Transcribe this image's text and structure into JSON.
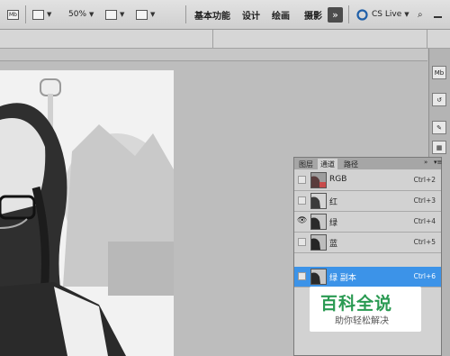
{
  "toolbar": {
    "mb_label": "Mb",
    "zoom_value": "50%",
    "workspaces": [
      "基本功能",
      "设计",
      "绘画",
      "摄影"
    ],
    "more_label": "»",
    "cslive_label": "CS Live"
  },
  "dock": {
    "icons": [
      "mini-bridge-icon",
      "history-icon",
      "brush-icon",
      "grid-icon"
    ],
    "mb_label": "Mb"
  },
  "channels_panel": {
    "tabs": [
      "图层",
      "通道",
      "路径"
    ],
    "active_tab": "通道",
    "channels": [
      {
        "name": "RGB",
        "shortcut": "Ctrl+2",
        "visible": false,
        "selected": false
      },
      {
        "name": "红",
        "shortcut": "Ctrl+3",
        "visible": false,
        "selected": false
      },
      {
        "name": "绿",
        "shortcut": "Ctrl+4",
        "visible": true,
        "selected": false
      },
      {
        "name": "蓝",
        "shortcut": "Ctrl+5",
        "visible": false,
        "selected": false
      },
      {
        "name": "绿 副本",
        "shortcut": "Ctrl+6",
        "visible": false,
        "selected": true
      }
    ]
  },
  "watermark": {
    "title": "百科全说",
    "subtitle": "助你轻松解决"
  },
  "colors": {
    "selected_row": "#3c93e8",
    "watermark_green": "#2a9a52"
  }
}
